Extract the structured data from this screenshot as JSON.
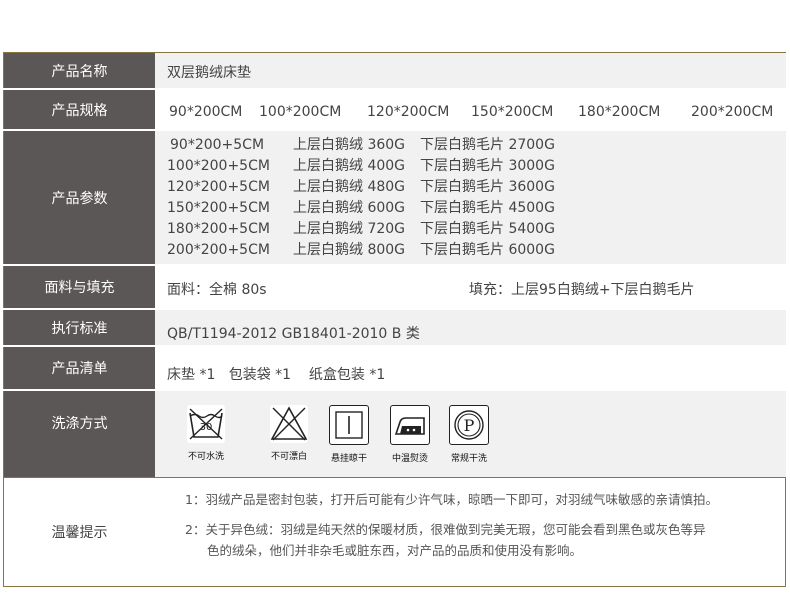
{
  "rows": {
    "name": {
      "label": "产品名称",
      "value": "双层鹅绒床垫"
    },
    "spec": {
      "label": "产品规格",
      "sizes": [
        "90*200CM",
        "100*200CM",
        "120*200CM",
        "150*200CM",
        "180*200CM",
        "200*200CM"
      ]
    },
    "params": {
      "label": "产品参数",
      "lines": [
        {
          "size": "90*200+5CM",
          "upper": "上层白鹅绒 360G",
          "lower": "下层白鹅毛片 2700G"
        },
        {
          "size": "100*200+5CM",
          "upper": "上层白鹅绒 400G",
          "lower": "下层白鹅毛片 3000G"
        },
        {
          "size": "120*200+5CM",
          "upper": "上层白鹅绒 480G",
          "lower": "下层白鹅毛片 3600G"
        },
        {
          "size": "150*200+5CM",
          "upper": "上层白鹅绒 600G",
          "lower": "下层白鹅毛片 4500G"
        },
        {
          "size": "180*200+5CM",
          "upper": "上层白鹅绒 720G",
          "lower": "下层白鹅毛片 5400G"
        },
        {
          "size": "200*200+5CM",
          "upper": "上层白鹅绒 800G",
          "lower": "下层白鹅毛片 6000G"
        }
      ]
    },
    "fabric": {
      "label": "面料与填充",
      "fabric": "面料：全棉 80s",
      "filling": "填充：上层95白鹅绒+下层白鹅毛片"
    },
    "standard": {
      "label": "执行标准",
      "value": "QB/T1194-2012  GB18401-2010  B 类"
    },
    "contents": {
      "label": "产品清单",
      "value": "床垫 *1   包装袋 *1    纸盒包装 *1"
    },
    "washing": {
      "label": "洗涤方式",
      "icons": [
        {
          "icon": "no-machine-wash-icon",
          "caption": "不可水洗",
          "temp": "30"
        },
        {
          "icon": "no-bleach-icon",
          "caption": "不可漂白"
        },
        {
          "icon": "hang-dry-icon",
          "caption": "悬挂晾干"
        },
        {
          "icon": "medium-iron-icon",
          "caption": "中温熨烫"
        },
        {
          "icon": "dry-clean-icon",
          "caption": "常规干洗",
          "letter": "P"
        }
      ]
    }
  },
  "tips": {
    "label": "温馨提示",
    "tip1": "1：羽绒产品是密封包装，打开后可能有少许气味，晾晒一下即可，对羽绒气味敏感的亲请慎拍。",
    "tip2_line1": "2：关于异色绒：羽绒是纯天然的保暖材质，很难做到完美无瑕，您可能会看到黑色或灰色等异",
    "tip2_line2": "色的绒朵，他们并非杂毛或脏东西，对产品的品质和使用没有影响。"
  },
  "colors": {
    "label_bg": "#5b5756",
    "value_bg": "#f1f1f1",
    "border": "#8a7440"
  }
}
